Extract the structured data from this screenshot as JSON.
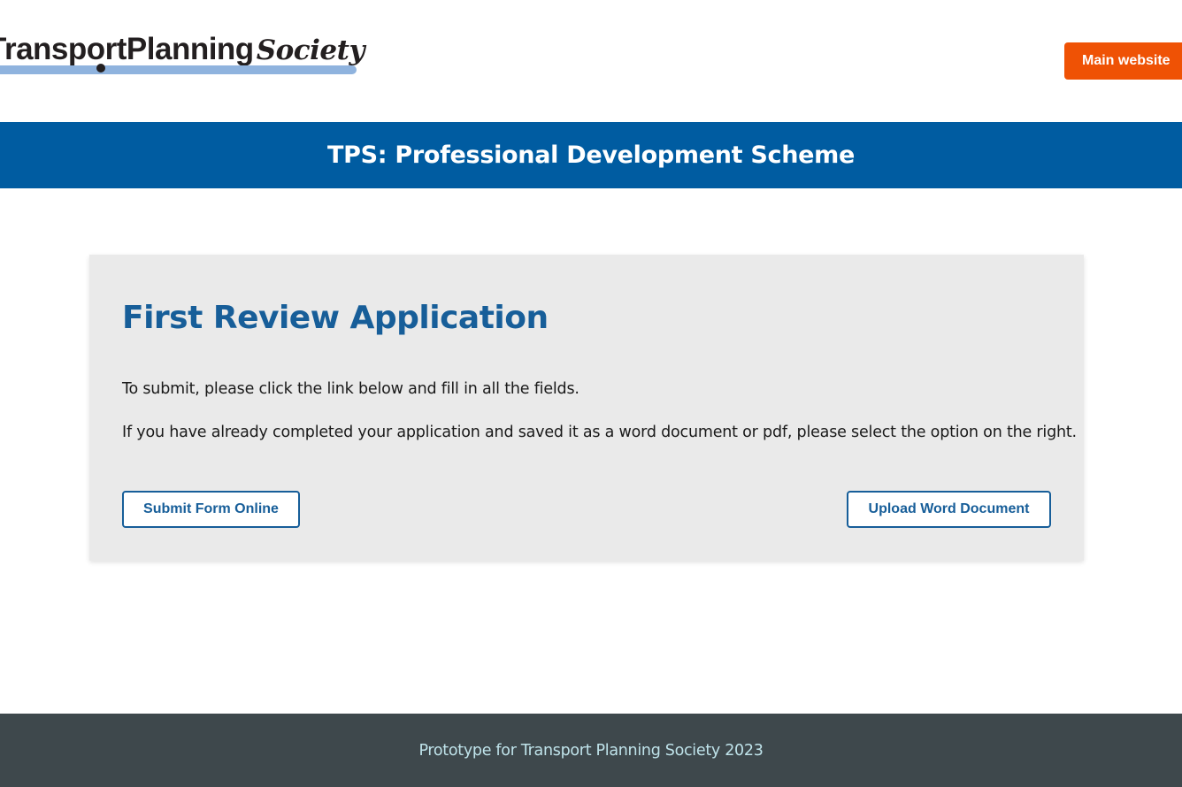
{
  "header": {
    "logo": {
      "bold_text": "TransportPlanning",
      "italic_text": "Society",
      "line_color": "#8fb3de"
    },
    "main_website_label": "Main website",
    "main_website_color": "#ef5205"
  },
  "banner": {
    "title": "TPS: Professional Development Scheme",
    "background": "#005ca1"
  },
  "card": {
    "title": "First Review Application",
    "paragraph1": "To submit, please click the link below and fill in all the fields.",
    "paragraph2": "If you have already completed your application and saved it as a word document or pdf, please select the option on the right.",
    "submit_button_label": "Submit Form Online",
    "upload_button_label": "Upload Word Document",
    "accent_color": "#175e99"
  },
  "footer": {
    "text": "Prototype for Transport Planning Society 2023",
    "background": "#3e484c"
  }
}
